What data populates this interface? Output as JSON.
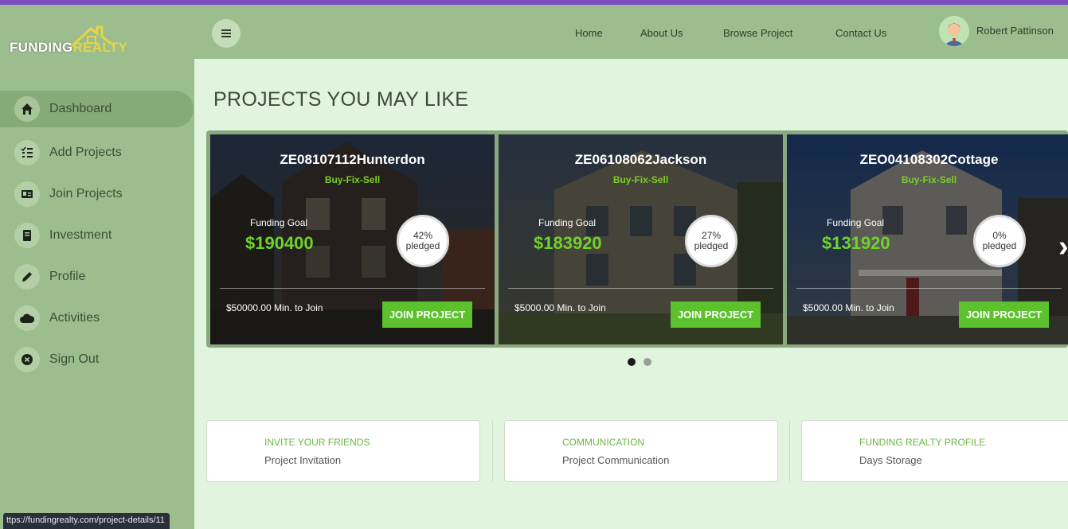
{
  "brand": {
    "word1": "FUNDING",
    "word2": "REALTY"
  },
  "status_url": "ttps://fundingrealty.com/project-details/11",
  "nav": {
    "items": [
      "Home",
      "About Us",
      "Browse Project",
      "Contact Us"
    ]
  },
  "user": {
    "name": "Robert Pattinson"
  },
  "sidebar": {
    "items": [
      {
        "label": "Dashboard",
        "icon": "home-icon"
      },
      {
        "label": "Add Projects",
        "icon": "checklist-icon"
      },
      {
        "label": "Join Projects",
        "icon": "id-card-icon"
      },
      {
        "label": "Investment",
        "icon": "document-icon"
      },
      {
        "label": "Profile",
        "icon": "pencil-icon"
      },
      {
        "label": "Activities",
        "icon": "cloud-icon"
      },
      {
        "label": "Sign Out",
        "icon": "close-circle-icon"
      }
    ]
  },
  "main": {
    "title": "PROJECTS YOU MAY LIKE",
    "projects": [
      {
        "name": "ZE08107112Hunterdon",
        "type": "Buy-Fix-Sell",
        "goal_label": "Funding Goal",
        "goal": "$190400",
        "pledged_pct": "42%",
        "pledged_label": "pledged",
        "min_join": "$50000.00 Min. to Join",
        "button": "JOIN PROJECT"
      },
      {
        "name": "ZE06108062Jackson",
        "type": "Buy-Fix-Sell",
        "goal_label": "Funding Goal",
        "goal": "$183920",
        "pledged_pct": "27%",
        "pledged_label": "pledged",
        "min_join": "$5000.00 Min. to Join",
        "button": "JOIN PROJECT"
      },
      {
        "name": "ZEO04108302Cottage",
        "type": "Buy-Fix-Sell",
        "goal_label": "Funding Goal",
        "goal": "$131920",
        "pledged_pct": "0%",
        "pledged_label": "pledged",
        "min_join": "$5000.00 Min. to Join",
        "button": "JOIN PROJECT"
      }
    ],
    "carousel": {
      "pages": 2,
      "active": 1
    },
    "info": [
      {
        "title": "INVITE YOUR FRIENDS",
        "subtitle": "Project Invitation"
      },
      {
        "title": "COMMUNICATION",
        "subtitle": "Project Communication"
      },
      {
        "title": "FUNDING REALTY PROFILE",
        "subtitle": "Days Storage"
      }
    ]
  },
  "colors": {
    "sidebar": "#9cbe8e",
    "main_bg": "#e0f4de",
    "accent_green": "#5cc12c",
    "top_line": "#7b4fc2"
  }
}
